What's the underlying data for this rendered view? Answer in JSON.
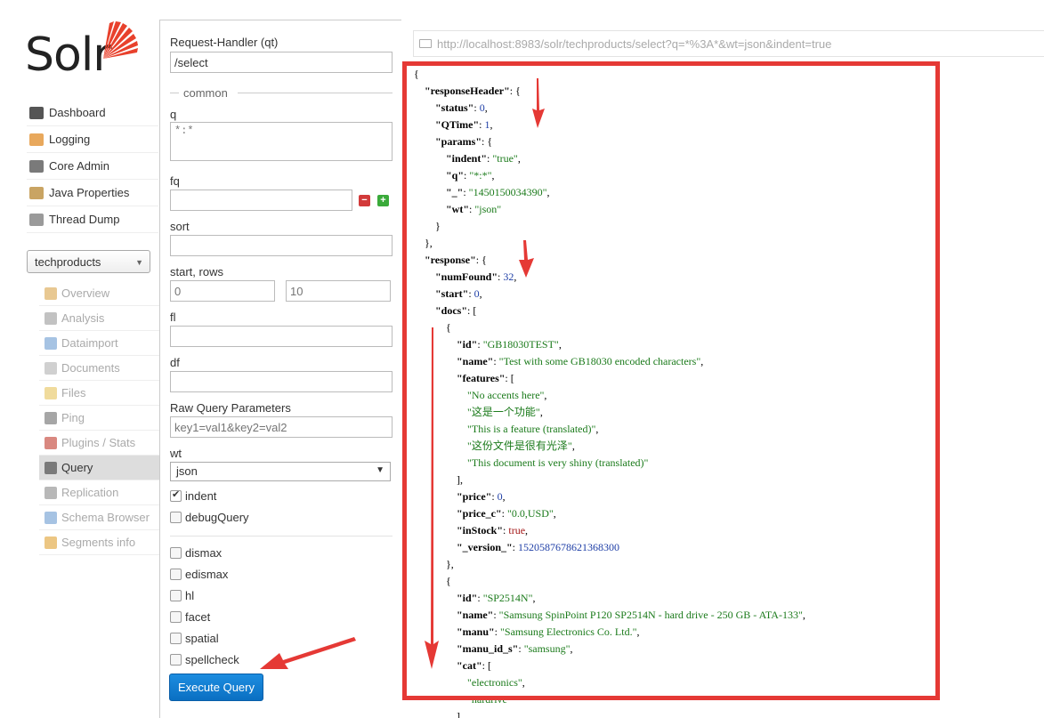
{
  "app": {
    "logo_text": "Solr"
  },
  "main_nav": [
    {
      "label": "Dashboard",
      "icon": "dashboard-icon",
      "color": "#555555"
    },
    {
      "label": "Logging",
      "icon": "logging-icon",
      "color": "#e8a85c"
    },
    {
      "label": "Core Admin",
      "icon": "core-admin-icon",
      "color": "#7a7a7a"
    },
    {
      "label": "Java Properties",
      "icon": "java-properties-icon",
      "color": "#c9a463"
    },
    {
      "label": "Thread Dump",
      "icon": "thread-dump-icon",
      "color": "#9a9a9a"
    }
  ],
  "core_selector": {
    "value": "techproducts"
  },
  "core_nav": [
    {
      "label": "Overview",
      "icon": "home-icon",
      "color": "#d9a44a",
      "active": false
    },
    {
      "label": "Analysis",
      "icon": "analysis-icon",
      "color": "#999999",
      "active": false
    },
    {
      "label": "Dataimport",
      "icon": "dataimport-icon",
      "color": "#6b9bd1",
      "active": false
    },
    {
      "label": "Documents",
      "icon": "documents-icon",
      "color": "#b0b0b0",
      "active": false
    },
    {
      "label": "Files",
      "icon": "files-icon",
      "color": "#e6c35a",
      "active": false
    },
    {
      "label": "Ping",
      "icon": "ping-icon",
      "color": "#6a6a6a",
      "active": false
    },
    {
      "label": "Plugins / Stats",
      "icon": "plugins-icon",
      "color": "#c0392b",
      "active": false
    },
    {
      "label": "Query",
      "icon": "query-icon",
      "color": "#7a7a7a",
      "active": true
    },
    {
      "label": "Replication",
      "icon": "replication-icon",
      "color": "#888888",
      "active": false
    },
    {
      "label": "Schema Browser",
      "icon": "schema-browser-icon",
      "color": "#6b9bd1",
      "active": false
    },
    {
      "label": "Segments info",
      "icon": "segments-icon",
      "color": "#e0a030",
      "active": false
    }
  ],
  "form": {
    "request_handler_label": "Request-Handler (qt)",
    "request_handler_value": "/select",
    "common_legend": "common",
    "q_label": "q",
    "q_value": "*:*",
    "fq_label": "fq",
    "fq_value": "",
    "sort_label": "sort",
    "sort_value": "",
    "start_rows_label": "start, rows",
    "start_placeholder": "0",
    "rows_placeholder": "10",
    "fl_label": "fl",
    "fl_value": "",
    "df_label": "df",
    "df_value": "",
    "raw_label": "Raw Query Parameters",
    "raw_placeholder": "key1=val1&key2=val2",
    "wt_label": "wt",
    "wt_value": "json",
    "indent_label": "indent",
    "indent_checked": true,
    "debug_label": "debugQuery",
    "debug_checked": false,
    "options": [
      {
        "label": "dismax",
        "checked": false
      },
      {
        "label": "edismax",
        "checked": false
      },
      {
        "label": "hl",
        "checked": false
      },
      {
        "label": "facet",
        "checked": false
      },
      {
        "label": "spatial",
        "checked": false
      },
      {
        "label": "spellcheck",
        "checked": false
      }
    ],
    "execute_label": "Execute Query"
  },
  "result": {
    "url": "http://localhost:8983/solr/techproducts/select?q=*%3A*&wt=json&indent=true",
    "highlight_color": "#e53935",
    "lines": [
      {
        "indent": 0,
        "parts": [
          {
            "t": "p",
            "v": "{"
          }
        ]
      },
      {
        "indent": 1,
        "parts": [
          {
            "t": "k",
            "v": "\"responseHeader\""
          },
          {
            "t": "p",
            "v": ": {"
          }
        ]
      },
      {
        "indent": 2,
        "parts": [
          {
            "t": "k",
            "v": "\"status\""
          },
          {
            "t": "p",
            "v": ": "
          },
          {
            "t": "n",
            "v": "0"
          },
          {
            "t": "p",
            "v": ","
          }
        ]
      },
      {
        "indent": 2,
        "parts": [
          {
            "t": "k",
            "v": "\"QTime\""
          },
          {
            "t": "p",
            "v": ": "
          },
          {
            "t": "n",
            "v": "1"
          },
          {
            "t": "p",
            "v": ","
          }
        ]
      },
      {
        "indent": 2,
        "parts": [
          {
            "t": "k",
            "v": "\"params\""
          },
          {
            "t": "p",
            "v": ": {"
          }
        ]
      },
      {
        "indent": 3,
        "parts": [
          {
            "t": "k",
            "v": "\"indent\""
          },
          {
            "t": "p",
            "v": ": "
          },
          {
            "t": "s",
            "v": "\"true\""
          },
          {
            "t": "p",
            "v": ","
          }
        ]
      },
      {
        "indent": 3,
        "parts": [
          {
            "t": "k",
            "v": "\"q\""
          },
          {
            "t": "p",
            "v": ": "
          },
          {
            "t": "s",
            "v": "\"*:*\""
          },
          {
            "t": "p",
            "v": ","
          }
        ]
      },
      {
        "indent": 3,
        "parts": [
          {
            "t": "k",
            "v": "\"_\""
          },
          {
            "t": "p",
            "v": ": "
          },
          {
            "t": "s",
            "v": "\"1450150034390\""
          },
          {
            "t": "p",
            "v": ","
          }
        ]
      },
      {
        "indent": 3,
        "parts": [
          {
            "t": "k",
            "v": "\"wt\""
          },
          {
            "t": "p",
            "v": ": "
          },
          {
            "t": "s",
            "v": "\"json\""
          }
        ]
      },
      {
        "indent": 2,
        "parts": [
          {
            "t": "p",
            "v": "}"
          }
        ]
      },
      {
        "indent": 1,
        "parts": [
          {
            "t": "p",
            "v": "},"
          }
        ]
      },
      {
        "indent": 1,
        "parts": [
          {
            "t": "k",
            "v": "\"response\""
          },
          {
            "t": "p",
            "v": ": {"
          }
        ]
      },
      {
        "indent": 2,
        "parts": [
          {
            "t": "k",
            "v": "\"numFound\""
          },
          {
            "t": "p",
            "v": ": "
          },
          {
            "t": "n",
            "v": "32"
          },
          {
            "t": "p",
            "v": ","
          }
        ]
      },
      {
        "indent": 2,
        "parts": [
          {
            "t": "k",
            "v": "\"start\""
          },
          {
            "t": "p",
            "v": ": "
          },
          {
            "t": "n",
            "v": "0"
          },
          {
            "t": "p",
            "v": ","
          }
        ]
      },
      {
        "indent": 2,
        "parts": [
          {
            "t": "k",
            "v": "\"docs\""
          },
          {
            "t": "p",
            "v": ": ["
          }
        ]
      },
      {
        "indent": 3,
        "parts": [
          {
            "t": "p",
            "v": "{"
          }
        ]
      },
      {
        "indent": 4,
        "parts": [
          {
            "t": "k",
            "v": "\"id\""
          },
          {
            "t": "p",
            "v": ": "
          },
          {
            "t": "s",
            "v": "\"GB18030TEST\""
          },
          {
            "t": "p",
            "v": ","
          }
        ]
      },
      {
        "indent": 4,
        "parts": [
          {
            "t": "k",
            "v": "\"name\""
          },
          {
            "t": "p",
            "v": ": "
          },
          {
            "t": "s",
            "v": "\"Test with some GB18030 encoded characters\""
          },
          {
            "t": "p",
            "v": ","
          }
        ]
      },
      {
        "indent": 4,
        "parts": [
          {
            "t": "k",
            "v": "\"features\""
          },
          {
            "t": "p",
            "v": ": ["
          }
        ]
      },
      {
        "indent": 5,
        "parts": [
          {
            "t": "s",
            "v": "\"No accents here\""
          },
          {
            "t": "p",
            "v": ","
          }
        ]
      },
      {
        "indent": 5,
        "parts": [
          {
            "t": "s",
            "v": "\"这是一个功能\""
          },
          {
            "t": "p",
            "v": ","
          }
        ]
      },
      {
        "indent": 5,
        "parts": [
          {
            "t": "s",
            "v": "\"This is a feature (translated)\""
          },
          {
            "t": "p",
            "v": ","
          }
        ]
      },
      {
        "indent": 5,
        "parts": [
          {
            "t": "s",
            "v": "\"这份文件是很有光泽\""
          },
          {
            "t": "p",
            "v": ","
          }
        ]
      },
      {
        "indent": 5,
        "parts": [
          {
            "t": "s",
            "v": "\"This document is very shiny (translated)\""
          }
        ]
      },
      {
        "indent": 4,
        "parts": [
          {
            "t": "p",
            "v": "],"
          }
        ]
      },
      {
        "indent": 4,
        "parts": [
          {
            "t": "k",
            "v": "\"price\""
          },
          {
            "t": "p",
            "v": ": "
          },
          {
            "t": "n",
            "v": "0"
          },
          {
            "t": "p",
            "v": ","
          }
        ]
      },
      {
        "indent": 4,
        "parts": [
          {
            "t": "k",
            "v": "\"price_c\""
          },
          {
            "t": "p",
            "v": ": "
          },
          {
            "t": "s",
            "v": "\"0.0,USD\""
          },
          {
            "t": "p",
            "v": ","
          }
        ]
      },
      {
        "indent": 4,
        "parts": [
          {
            "t": "k",
            "v": "\"inStock\""
          },
          {
            "t": "p",
            "v": ": "
          },
          {
            "t": "b",
            "v": "true"
          },
          {
            "t": "p",
            "v": ","
          }
        ]
      },
      {
        "indent": 4,
        "parts": [
          {
            "t": "k",
            "v": "\"_version_\""
          },
          {
            "t": "p",
            "v": ": "
          },
          {
            "t": "n",
            "v": "1520587678621368300"
          }
        ]
      },
      {
        "indent": 3,
        "parts": [
          {
            "t": "p",
            "v": "},"
          }
        ]
      },
      {
        "indent": 3,
        "parts": [
          {
            "t": "p",
            "v": "{"
          }
        ]
      },
      {
        "indent": 4,
        "parts": [
          {
            "t": "k",
            "v": "\"id\""
          },
          {
            "t": "p",
            "v": ": "
          },
          {
            "t": "s",
            "v": "\"SP2514N\""
          },
          {
            "t": "p",
            "v": ","
          }
        ]
      },
      {
        "indent": 4,
        "parts": [
          {
            "t": "k",
            "v": "\"name\""
          },
          {
            "t": "p",
            "v": ": "
          },
          {
            "t": "s",
            "v": "\"Samsung SpinPoint P120 SP2514N - hard drive - 250 GB - ATA-133\""
          },
          {
            "t": "p",
            "v": ","
          }
        ]
      },
      {
        "indent": 4,
        "parts": [
          {
            "t": "k",
            "v": "\"manu\""
          },
          {
            "t": "p",
            "v": ": "
          },
          {
            "t": "s",
            "v": "\"Samsung Electronics Co. Ltd.\""
          },
          {
            "t": "p",
            "v": ","
          }
        ]
      },
      {
        "indent": 4,
        "parts": [
          {
            "t": "k",
            "v": "\"manu_id_s\""
          },
          {
            "t": "p",
            "v": ": "
          },
          {
            "t": "s",
            "v": "\"samsung\""
          },
          {
            "t": "p",
            "v": ","
          }
        ]
      },
      {
        "indent": 4,
        "parts": [
          {
            "t": "k",
            "v": "\"cat\""
          },
          {
            "t": "p",
            "v": ": ["
          }
        ]
      },
      {
        "indent": 5,
        "parts": [
          {
            "t": "s",
            "v": "\"electronics\""
          },
          {
            "t": "p",
            "v": ","
          }
        ]
      },
      {
        "indent": 5,
        "parts": [
          {
            "t": "s",
            "v": "\"hardrive\""
          }
        ]
      },
      {
        "indent": 4,
        "parts": [
          {
            "t": "p",
            "v": "],"
          }
        ]
      }
    ]
  }
}
